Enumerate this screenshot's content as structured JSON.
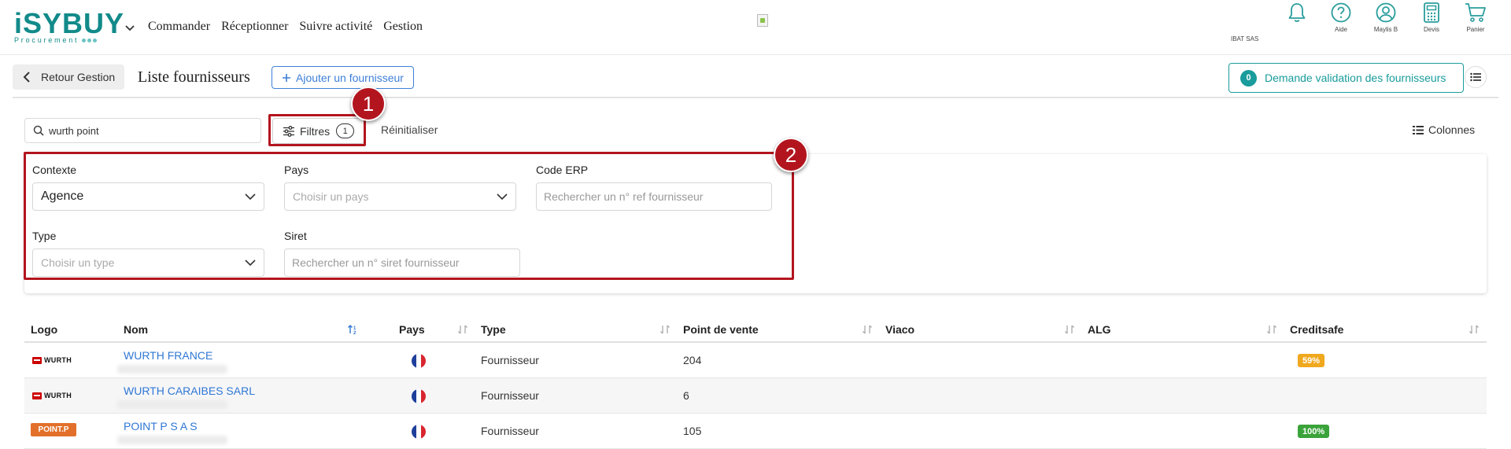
{
  "brand": {
    "logo_text": "iSYBUY",
    "logo_sub": "Procurement"
  },
  "nav": {
    "items": [
      "Commander",
      "Réceptionner",
      "Suivre activité",
      "Gestion"
    ]
  },
  "header_right": {
    "company": "IBAT SAS",
    "help_label": "Aide",
    "user_label": "Maylis B",
    "quotes_label": "Devis",
    "cart_label": "Panier"
  },
  "subheader": {
    "back_label": "Retour Gestion",
    "title": "Liste fournisseurs",
    "add_label": "Ajouter un fournisseur",
    "validation_count": "0",
    "validation_label": "Demande validation des fournisseurs"
  },
  "toolbar": {
    "search_value": "wurth point",
    "filters_label": "Filtres",
    "filters_count": "1",
    "reset_label": "Réinitialiser",
    "columns_label": "Colonnes"
  },
  "filters": {
    "contexte": {
      "label": "Contexte",
      "value": "Agence"
    },
    "pays": {
      "label": "Pays",
      "placeholder": "Choisir un pays"
    },
    "code_erp": {
      "label": "Code ERP",
      "placeholder": "Rechercher un n° ref fournisseur"
    },
    "type": {
      "label": "Type",
      "placeholder": "Choisir un type"
    },
    "siret": {
      "label": "Siret",
      "placeholder": "Rechercher un n° siret fournisseur"
    }
  },
  "annotations": {
    "badge_1": "1",
    "badge_2": "2"
  },
  "table": {
    "headers": {
      "logo": "Logo",
      "nom": "Nom",
      "pays": "Pays",
      "type": "Type",
      "point_de_vente": "Point de vente",
      "viaco": "Viaco",
      "alg": "ALG",
      "creditsafe": "Creditsafe"
    },
    "rows": [
      {
        "logo": "WURTH",
        "nom": "WURTH FRANCE",
        "type": "Fournisseur",
        "point_de_vente": "204",
        "creditsafe": "59%"
      },
      {
        "logo": "WURTH",
        "nom": "WURTH CARAIBES SARL",
        "type": "Fournisseur",
        "point_de_vente": "6",
        "creditsafe": ""
      },
      {
        "logo": "POINT.P",
        "nom": "POINT P S A S",
        "type": "Fournisseur",
        "point_de_vente": "105",
        "creditsafe": "100%"
      }
    ]
  },
  "colors": {
    "brand_teal": "#128a8a",
    "link_blue": "#2f77d4",
    "annotation_red": "#b3151e",
    "score_orange": "#f0a81e",
    "score_green": "#3aa33a"
  }
}
